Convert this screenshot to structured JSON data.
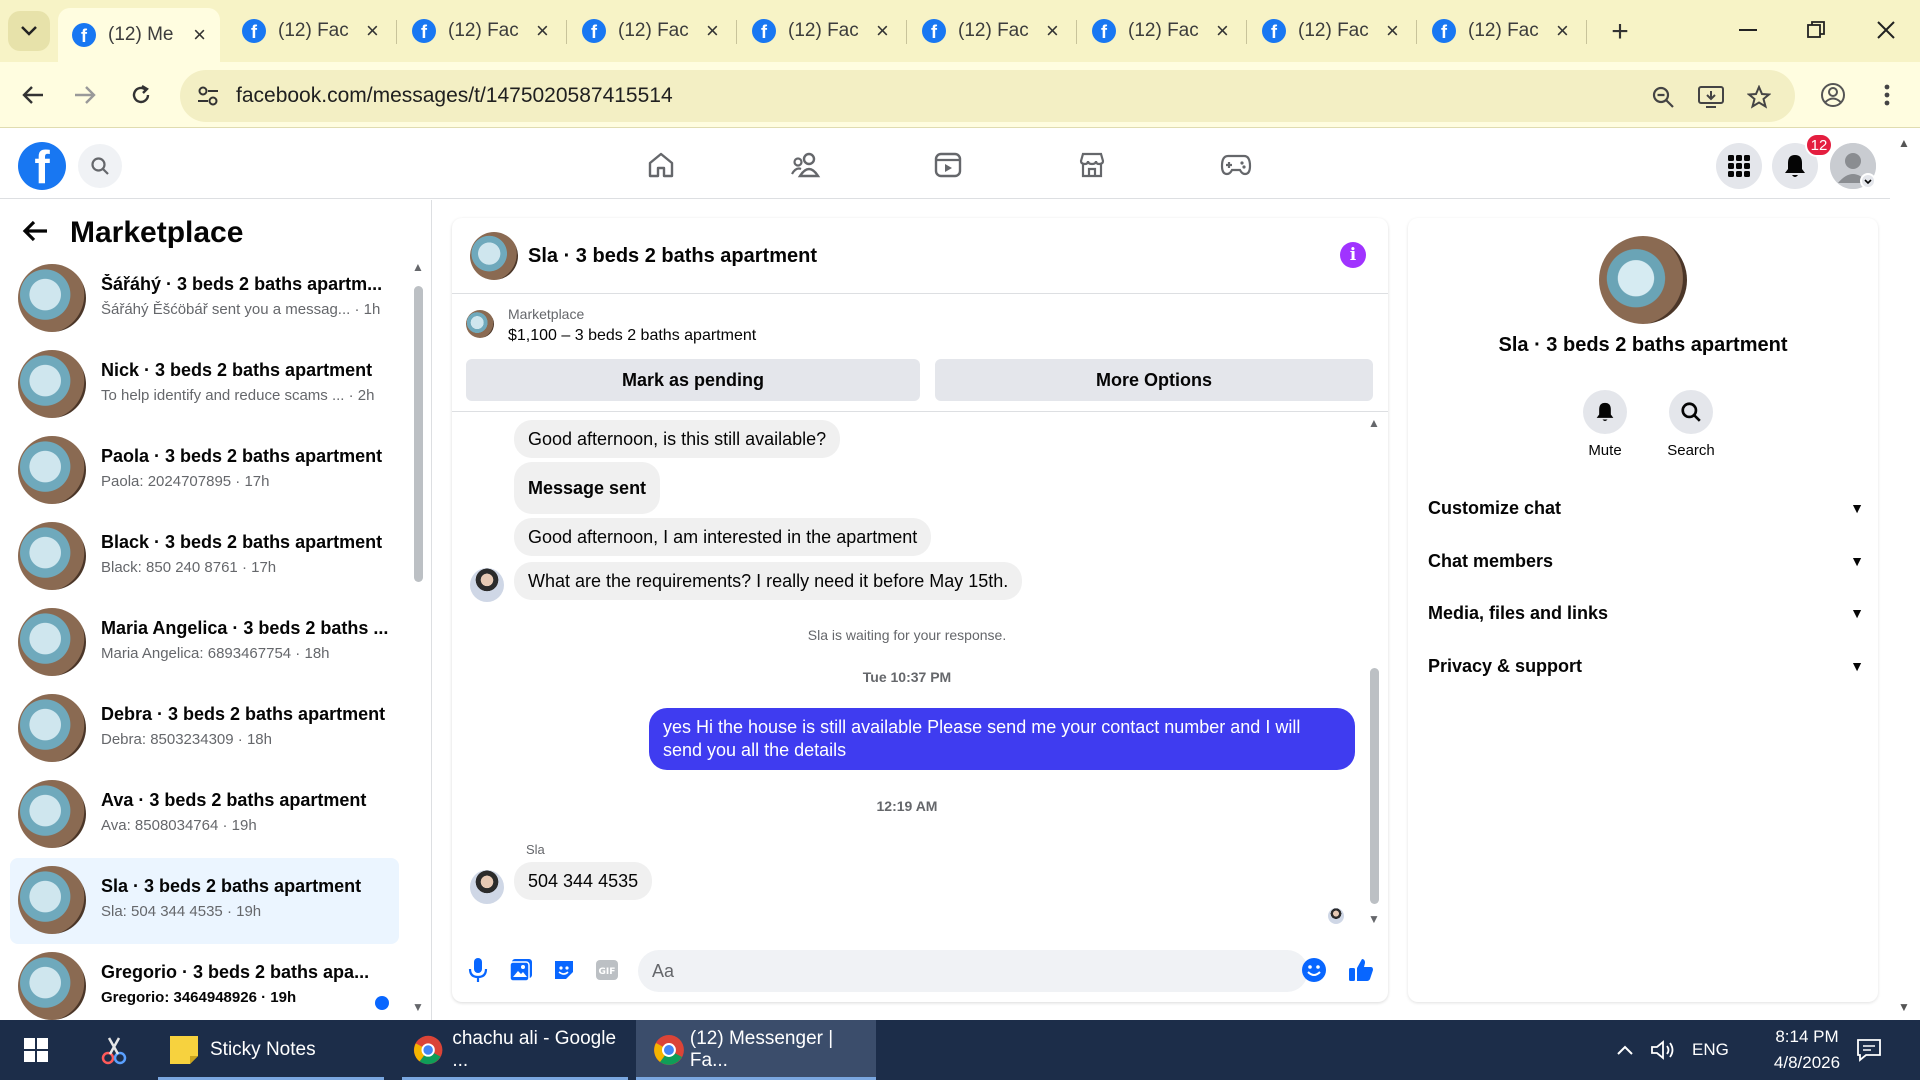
{
  "browser": {
    "tabs": [
      {
        "title": "(12) Me",
        "active": true
      },
      {
        "title": "(12) Fac",
        "active": false
      },
      {
        "title": "(12) Fac",
        "active": false
      },
      {
        "title": "(12) Fac",
        "active": false
      },
      {
        "title": "(12) Fac",
        "active": false
      },
      {
        "title": "(12) Fac",
        "active": false
      },
      {
        "title": "(12) Fac",
        "active": false
      },
      {
        "title": "(12) Fac",
        "active": false
      },
      {
        "title": "(12) Fac",
        "active": false
      }
    ],
    "url": "facebook.com/messages/t/1475020587415514",
    "colors": {
      "tabstrip": "#f7f3c6",
      "toolbar": "#fffde0"
    }
  },
  "fb": {
    "notification_count": "12",
    "brand_color": "#1877f2"
  },
  "sidebar": {
    "title": "Marketplace",
    "conversations": [
      {
        "name": "Šářáhý · 3 beds 2 baths apartm...",
        "sub": "Šářáhý Ěšćöbář sent you a messag... · 1h",
        "selected": false,
        "unread": false
      },
      {
        "name": "Nick · 3 beds 2 baths apartment",
        "sub": "To help identify and reduce scams ... · 2h",
        "selected": false,
        "unread": false
      },
      {
        "name": "Paola · 3 beds 2 baths apartment",
        "sub": "Paola: 2024707895 · 17h",
        "selected": false,
        "unread": false
      },
      {
        "name": "Black · 3 beds 2 baths apartment",
        "sub": "Black: 850 240 8761 · 17h",
        "selected": false,
        "unread": false
      },
      {
        "name": "Maria Angelica · 3 beds 2 baths ...",
        "sub": "Maria Angelica: 6893467754 · 18h",
        "selected": false,
        "unread": false
      },
      {
        "name": "Debra · 3 beds 2 baths apartment",
        "sub": "Debra: 8503234309 · 18h",
        "selected": false,
        "unread": false
      },
      {
        "name": "Ava · 3 beds 2 baths apartment",
        "sub": "Ava: 8508034764 · 19h",
        "selected": false,
        "unread": false
      },
      {
        "name": "Sla · 3 beds 2 baths apartment",
        "sub": "Sla: 504 344 4535 · 19h",
        "selected": true,
        "unread": false
      },
      {
        "name": "Gregorio · 3 beds 2 baths apa...",
        "sub": "Gregorio: 3464948926 · 19h",
        "selected": false,
        "unread": true
      }
    ]
  },
  "chat": {
    "title": "Sla · 3 beds 2 baths apartment",
    "listing": {
      "label": "Marketplace",
      "price_line": "$1,100 – 3 beds 2 baths apartment",
      "mark_pending": "Mark as pending",
      "more_options": "More Options"
    },
    "messages": {
      "m1": "Good afternoon, is this still available?",
      "m2": "Message sent",
      "m3": "Good afternoon, I am interested in the apartment",
      "m4": "What are the requirements? I really need it before May 15th.",
      "waiting": "Sla is waiting for your response.",
      "time1": "Tue 10:37 PM",
      "me1": "yes Hi the house is still available Please send me your contact number and I will send you all the details",
      "time2": "12:19 AM",
      "sender": "Sla",
      "m5": "504 344 4535"
    },
    "composer_placeholder": "Aa",
    "my_bubble_color": "#3f3cf0"
  },
  "info": {
    "name": "Sla · 3 beds 2 baths apartment",
    "mute": "Mute",
    "search": "Search",
    "sections": [
      "Customize chat",
      "Chat members",
      "Media, files and links",
      "Privacy & support"
    ]
  },
  "taskbar": {
    "sticky_notes": "Sticky Notes",
    "chrome_1": "chachu ali - Google ...",
    "chrome_2": "(12) Messenger | Fa...",
    "language": "ENG",
    "time": "8:14 PM",
    "date": "4/8/2026"
  }
}
